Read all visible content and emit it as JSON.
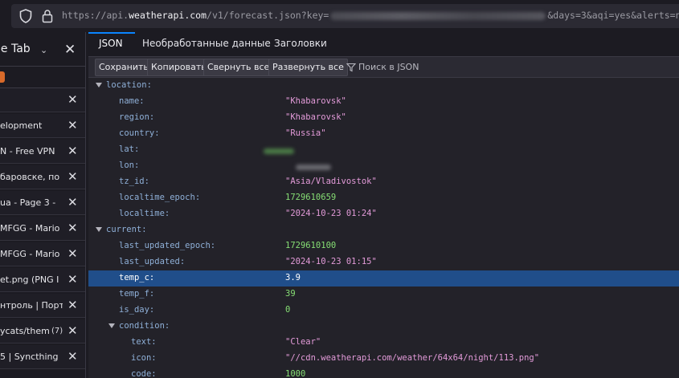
{
  "browser": {
    "url_prefix": "https://api.",
    "url_host": "weatherapi.com",
    "url_path": "/v1/forecast.json?key=",
    "url_suffix": "&days=3&aqi=yes&alerts=no"
  },
  "sidebar": {
    "title": "le Tab",
    "items": [
      {
        "label": ""
      },
      {
        "label": "elopment"
      },
      {
        "label": "N - Free VPN"
      },
      {
        "label": "баровске, по"
      },
      {
        "label": "ua - Page 3 -"
      },
      {
        "label": "MFGG - Mario"
      },
      {
        "label": "MFGG - Mario"
      },
      {
        "label": "et.png (PNG I"
      },
      {
        "label": "нтроль | Порт"
      },
      {
        "label": "ycats/them",
        "badge": "(7)"
      },
      {
        "label": "5 | Syncthing"
      }
    ]
  },
  "devtools": {
    "tabs": [
      "JSON",
      "Необработанные данные",
      "Заголовки"
    ],
    "toolbar": {
      "save": "Сохранить",
      "copy": "Копировать",
      "collapse": "Свернуть все",
      "expand": "Развернуть все",
      "filter_placeholder": "Поиск в JSON"
    }
  },
  "json_rows": [
    {
      "key": "location:",
      "value": "",
      "type": "obj",
      "level": 0
    },
    {
      "key": "name:",
      "value": "\"Khabarovsk\"",
      "type": "str",
      "level": 1
    },
    {
      "key": "region:",
      "value": "\"Khabarovsk\"",
      "type": "str",
      "level": 1
    },
    {
      "key": "country:",
      "value": "\"Russia\"",
      "type": "str",
      "level": 1
    },
    {
      "key": "lat:",
      "value": "",
      "type": "redacted",
      "level": 1
    },
    {
      "key": "lon:",
      "value": "",
      "type": "redacted",
      "level": 1
    },
    {
      "key": "tz_id:",
      "value": "\"Asia/Vladivostok\"",
      "type": "str",
      "level": 1
    },
    {
      "key": "localtime_epoch:",
      "value": "1729610659",
      "type": "num",
      "level": 1
    },
    {
      "key": "localtime:",
      "value": "\"2024-10-23 01:24\"",
      "type": "str",
      "level": 1
    },
    {
      "key": "current:",
      "value": "",
      "type": "obj",
      "level": 0
    },
    {
      "key": "last_updated_epoch:",
      "value": "1729610100",
      "type": "num",
      "level": 1
    },
    {
      "key": "last_updated:",
      "value": "\"2024-10-23 01:15\"",
      "type": "str",
      "level": 1
    },
    {
      "key": "temp_c:",
      "value": "3.9",
      "type": "num",
      "level": 1,
      "selected": true
    },
    {
      "key": "temp_f:",
      "value": "39",
      "type": "num",
      "level": 1
    },
    {
      "key": "is_day:",
      "value": "0",
      "type": "num",
      "level": 1
    },
    {
      "key": "condition:",
      "value": "",
      "type": "obj",
      "level": 1
    },
    {
      "key": "text:",
      "value": "\"Clear\"",
      "type": "str",
      "level": 2
    },
    {
      "key": "icon:",
      "value": "\"//cdn.weatherapi.com/weather/64x64/night/113.png\"",
      "type": "str",
      "level": 2
    },
    {
      "key": "code:",
      "value": "1000",
      "type": "num",
      "level": 2
    }
  ],
  "colors": {
    "string": "#e39bd9",
    "number": "#86de74",
    "key": "#8fb0d8",
    "selection": "#204e8a",
    "accent": "#0a84ff"
  }
}
